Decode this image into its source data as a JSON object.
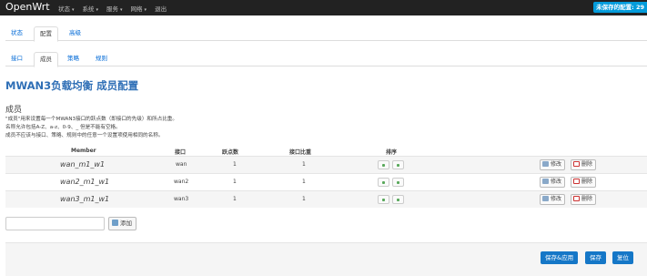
{
  "header": {
    "brand": "OpenWrt",
    "menu": [
      "状态",
      "系统",
      "服务",
      "网络",
      "退出"
    ],
    "unsaved_badge": "未保存的配置: 29"
  },
  "tabs_level1": [
    "状态",
    "配置",
    "高级"
  ],
  "tabs_level2": [
    "接口",
    "成员",
    "策略",
    "规则"
  ],
  "page_title": "MWAN3负载均衡 成员配置",
  "section": {
    "title": "成员",
    "description": [
      "\"成员\"用来设置每一个MWAN3接口的跃点数（即接口的先级）和所占比重。",
      "名称允许包括A-Z、a-z、0-9、_ 但是不能有空格。",
      "成员不应该与接口、策略、规则中的任意一个设置项使用相同的名称。"
    ]
  },
  "table": {
    "headers": {
      "member": "Member",
      "interface": "接口",
      "metric": "跃点数",
      "weight": "接口比重",
      "sort": "排序"
    },
    "rows": [
      {
        "name": "wan_m1_w1",
        "interface": "wan",
        "metric": "1",
        "weight": "1"
      },
      {
        "name": "wan2_m1_w1",
        "interface": "wan2",
        "metric": "1",
        "weight": "1"
      },
      {
        "name": "wan3_m1_w1",
        "interface": "wan3",
        "metric": "1",
        "weight": "1"
      }
    ],
    "edit_label": "修改",
    "delete_label": "删除"
  },
  "add": {
    "input_value": "",
    "button_label": "添加"
  },
  "footer": {
    "save_apply": "保存&应用",
    "save": "保存",
    "reset": "复位"
  },
  "colors": {
    "topbar": "#222222",
    "accent": "#1577c7",
    "title": "#2f6fb6",
    "badge": "#049cdb"
  }
}
